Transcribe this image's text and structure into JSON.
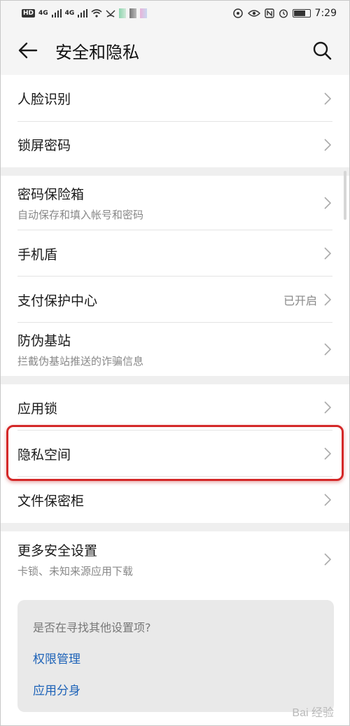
{
  "status_bar": {
    "left": [
      "HD",
      "4G",
      "4G"
    ],
    "time": "7:29"
  },
  "header": {
    "title": "安全和隐私"
  },
  "groups": [
    [
      {
        "label": "人脸识别"
      },
      {
        "label": "锁屏密码"
      }
    ],
    [
      {
        "label": "密码保险箱",
        "sub": "自动保存和填入帐号和密码"
      },
      {
        "label": "手机盾"
      },
      {
        "label": "支付保护中心",
        "status": "已开启"
      },
      {
        "label": "防伪基站",
        "sub": "拦截伪基站推送的诈骗信息"
      }
    ],
    [
      {
        "label": "应用锁"
      },
      {
        "label": "隐私空间"
      },
      {
        "label": "文件保密柜"
      }
    ],
    [
      {
        "label": "更多安全设置",
        "sub": "卡锁、未知来源应用下载"
      }
    ]
  ],
  "suggestion": {
    "question": "是否在寻找其他设置项?",
    "links": [
      "权限管理",
      "应用分身"
    ]
  },
  "watermark": "Bai 经验",
  "colors": {
    "link": "#1e63b8",
    "highlight": "#d42828",
    "background": "#efefef"
  }
}
